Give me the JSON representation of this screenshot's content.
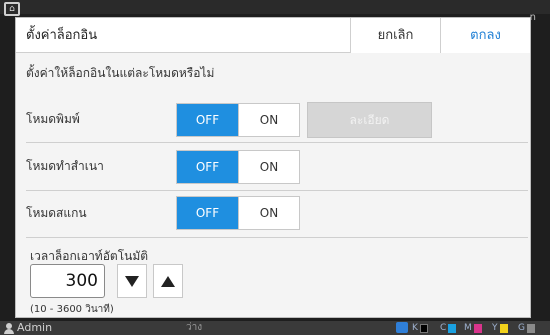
{
  "background": {
    "right_fragment": "n"
  },
  "dialog": {
    "title": "ตั้งค่าล็อกอิน",
    "cancel_label": "ยกเลิก",
    "ok_label": "ตกลง",
    "description": "ตั้งค่าให้ล็อกอินในแต่ละโหมดหรือไม่",
    "rows": [
      {
        "label": "โหมดพิมพ์",
        "off_label": "OFF",
        "on_label": "ON",
        "selected": "OFF",
        "detail_label": "ละเอียด",
        "detail_enabled": false
      },
      {
        "label": "โหมดทำสำเนา",
        "off_label": "OFF",
        "on_label": "ON",
        "selected": "OFF"
      },
      {
        "label": "โหมดสแกน",
        "off_label": "OFF",
        "on_label": "ON",
        "selected": "OFF"
      }
    ],
    "auto_logout": {
      "label": "เวลาล็อกเอาท์อัตโนมัติ",
      "value": "300",
      "range_hint": "(10 - 3600 วินาที)"
    }
  },
  "status_bar": {
    "user": "Admin",
    "state": "ว่าง",
    "inks": [
      {
        "label": "K",
        "color": "#000000"
      },
      {
        "label": "C",
        "color": "#1aa0e0"
      },
      {
        "label": "M",
        "color": "#d8348c"
      },
      {
        "label": "Y",
        "color": "#f2d21c"
      },
      {
        "label": "G",
        "color": "#8a8a8a"
      }
    ]
  },
  "colors": {
    "accent": "#1f8fe0",
    "ok_text": "#1f7fd4",
    "disabled_bg": "#d6d6d6"
  }
}
